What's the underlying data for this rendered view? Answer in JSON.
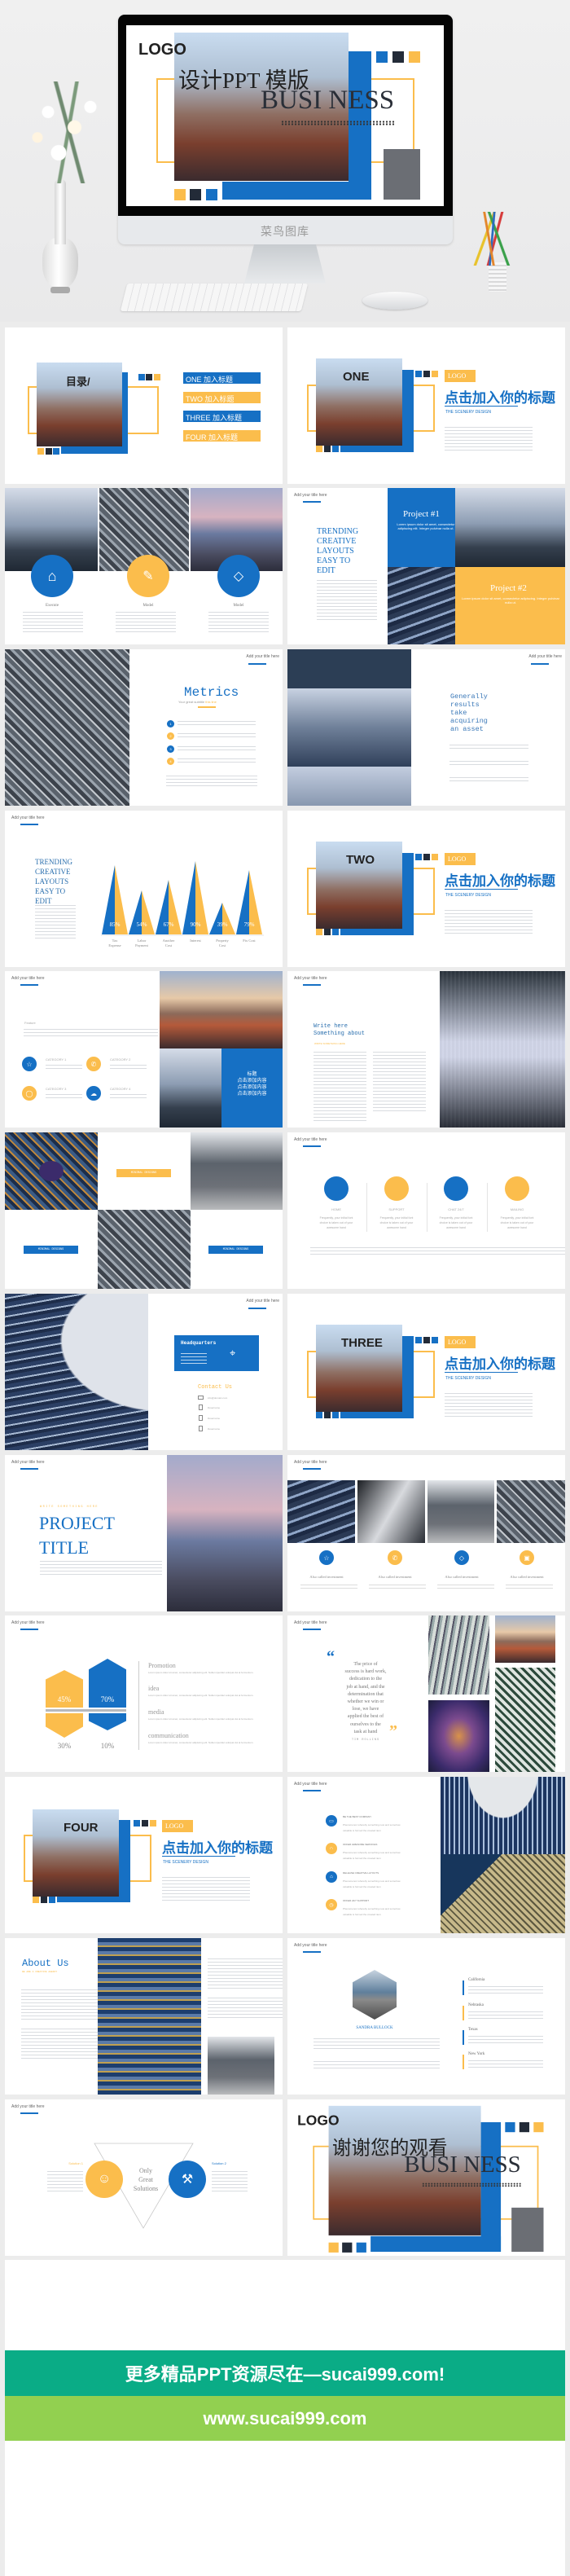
{
  "hero": {
    "logo": "LOGO",
    "title_cn": "设计PPT 模版",
    "title_en": "BUSI NESS",
    "monitor_brand": "菜鸟图库"
  },
  "colors": {
    "blue": "#1670c4",
    "yellow": "#fbbd4c",
    "dark": "#232b38",
    "grey": "#6b6e74",
    "banner_green": "#0aac86",
    "banner_lime": "#92d050"
  },
  "common": {
    "header": "Add your title here",
    "logo_tag": "LOGO",
    "section_title": "点击加入你的标题",
    "section_subtitle": "THE SCENERY DESIGN"
  },
  "toc": {
    "title": "目录/",
    "items": [
      {
        "label": "ONE  加入标题",
        "color": "#1670c4"
      },
      {
        "label": "TWO  加入标题",
        "color": "#fbbd4c"
      },
      {
        "label": "THREE  加入标题",
        "color": "#1670c4"
      },
      {
        "label": "FOUR  加入标题",
        "color": "#fbbd4c"
      }
    ]
  },
  "sections": [
    "ONE",
    "TWO",
    "THREE",
    "FOUR"
  ],
  "services": {
    "items": [
      {
        "label": "Execute",
        "icon": "home-icon"
      },
      {
        "label": "Model",
        "icon": "edit-icon"
      },
      {
        "label": "Model",
        "icon": "diamond-icon"
      }
    ]
  },
  "projects": {
    "heading": [
      "TRENDING",
      "CREATIVE",
      "LAYOUTS",
      "EASY TO",
      "EDIT"
    ],
    "p1_title": "Project #1",
    "p1_text": "Lorem ipsum dolor sit amet, consectetur adipiscing elit. Integer pulvinar nulla ut.",
    "p2_title": "Project #2",
    "p2_text": "Lorem ipsum dolor sit amet, consectetur adipiscing. Integer pulvinar nulla ut."
  },
  "metrics": {
    "title": "Metrics",
    "subtitle": "Your great subtitle",
    "subtitle_accent": "this line",
    "numbers": [
      "1",
      "2",
      "3",
      "4"
    ]
  },
  "generally": {
    "lines": [
      "Generally",
      "results",
      "take",
      "acquiring",
      "an asset"
    ]
  },
  "costs": {
    "heading": [
      "TRENDING",
      "CREATIVE",
      "LAYOUTS",
      "EASY TO",
      "EDIT"
    ],
    "values": [
      85,
      54,
      67,
      90,
      39,
      79
    ],
    "labels": [
      "85%",
      "54%",
      "67%",
      "90%",
      "39%",
      "79%"
    ],
    "categories": [
      [
        "Tax",
        "Expense"
      ],
      [
        "Labor",
        "Payment"
      ],
      [
        "Another",
        "Cost"
      ],
      [
        "Interest",
        ""
      ],
      [
        "Property",
        "Cost"
      ],
      [
        "Fix Cost",
        ""
      ]
    ]
  },
  "categories": {
    "feature": "Feature",
    "items": [
      {
        "label": "CATEGORY 1",
        "icon": "star-icon",
        "color": "#1670c4"
      },
      {
        "label": "CATEGORY 2",
        "icon": "phone-icon",
        "color": "#fbbd4c"
      },
      {
        "label": "CATEGORY 3",
        "icon": "bulb-icon",
        "color": "#fbbd4c"
      },
      {
        "label": "CATEGORY 4",
        "icon": "cloud-icon",
        "color": "#1670c4"
      }
    ],
    "box_lines": [
      "标题",
      "点击添加内容",
      "点击添加内容",
      "点击添加内容"
    ]
  },
  "write": {
    "line1": "Write here",
    "line2": "Something about",
    "accent": "WRITE SOMETHING HERE"
  },
  "minimal": {
    "button": "MINIMAL DESIGNS"
  },
  "support": {
    "items": [
      "HOME",
      "SUPPORT",
      "CHAT 24/7",
      "MAILING"
    ],
    "text": "Frequently, your initial font choice is taken out of your awesome hand"
  },
  "contact": {
    "hq": "Headquarters",
    "title": "Contact Us",
    "rows": [
      {
        "icon": "mail-icon",
        "text": "info@domain.com"
      },
      {
        "icon": "facebook-icon",
        "text": "#username"
      },
      {
        "icon": "twitter-icon",
        "text": "#username"
      },
      {
        "icon": "pinterest-icon",
        "text": "#username"
      }
    ]
  },
  "project_title": {
    "kicker": "WRITE SOMETHING HERE",
    "line1": "PROJECT",
    "line2": "TITLE"
  },
  "invest": {
    "label": "Also called investment",
    "icons": [
      "star-icon",
      "phone-icon",
      "diamond-icon",
      "image-icon"
    ]
  },
  "hex": {
    "values": [
      "45%",
      "70%",
      "30%",
      "10%"
    ],
    "items": [
      "Promotion",
      "idea",
      "media",
      "communication"
    ],
    "text": "Lorem ipsum dolor sit amet, consectetur adipiscing elit. Nulla imperdiet volutpat dui at fermentum."
  },
  "quote": {
    "open": "“",
    "close": "”",
    "lines": [
      "The price of",
      "success is hard work,",
      "dedication to the",
      "job at hand, and the",
      "determination that",
      "whether we win or",
      "lose, we have",
      "applied the best of",
      "ourselves to the",
      "task at hand"
    ],
    "author": "TIM ROLLINS"
  },
  "features": {
    "items": [
      {
        "label": "BE THE BEST COMPANY",
        "color": "#1670c4",
        "icon": "laptop-icon"
      },
      {
        "label": "OFFER AWESOME SERVICES",
        "color": "#fbbd4c",
        "icon": "headset-icon"
      },
      {
        "label": "RELEASE CREATIVE LAYOUTS",
        "color": "#1670c4",
        "icon": "box-icon"
      },
      {
        "label": "OFFER 24/7 SUPPORT",
        "color": "#fbbd4c",
        "icon": "clock-icon"
      }
    ],
    "text": "Phenomenon whereby something new and somehow valuable is formed the created item"
  },
  "about": {
    "title": "About Us",
    "subtitle": "WE ARE A CREATIVE AGENCY"
  },
  "team": {
    "name": "SANDRA BULLOCK",
    "locations": [
      {
        "name": "California",
        "color": "#1670c4"
      },
      {
        "name": "Nebraska",
        "color": "#fbbd4c"
      },
      {
        "name": "Texas",
        "color": "#1670c4"
      },
      {
        "name": "New York",
        "color": "#fbbd4c"
      }
    ]
  },
  "solutions": {
    "center": [
      "Only",
      "Great",
      "Solutions"
    ],
    "s1": "Solution 1",
    "s2": "Solution 2"
  },
  "thanks": {
    "logo": "LOGO",
    "title_cn": "谢谢您的观看",
    "title_en": "BUSI NESS"
  },
  "footer": {
    "banner": "更多精品PPT资源尽在—sucai999.com!",
    "url": "www.sucai999.com"
  }
}
